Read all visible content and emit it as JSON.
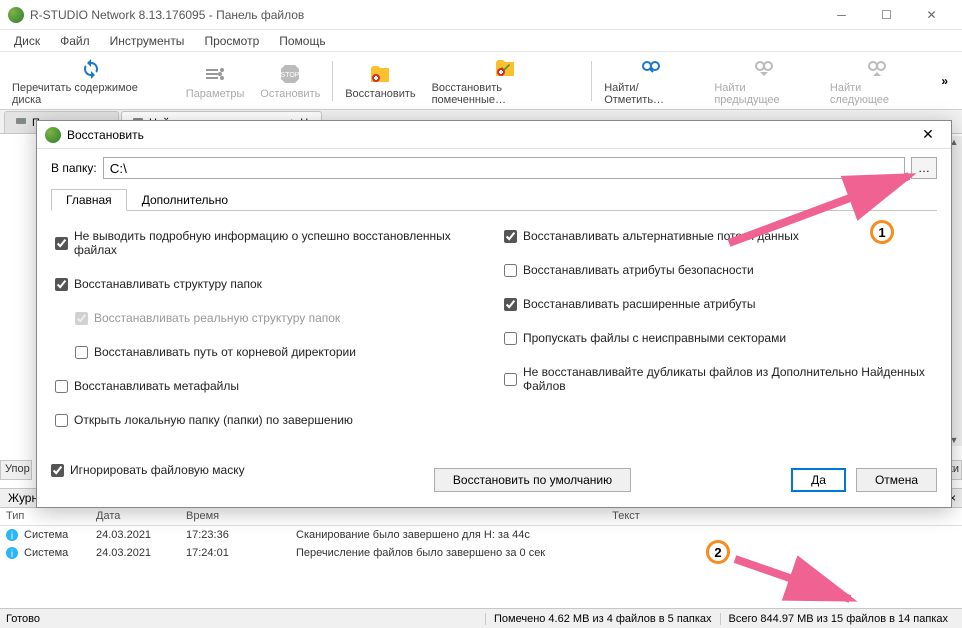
{
  "title": "R-STUDIO Network 8.13.176095 - Панель файлов",
  "menubar": [
    "Диск",
    "Файл",
    "Инструменты",
    "Просмотр",
    "Помощь"
  ],
  "toolbar": [
    {
      "label": "Перечитать содержимое диска",
      "kind": "refresh",
      "enabled": true
    },
    {
      "label": "Параметры",
      "kind": "params",
      "enabled": false
    },
    {
      "label": "Остановить",
      "kind": "stop",
      "enabled": false
    },
    {
      "sep": true
    },
    {
      "label": "Восстановить",
      "kind": "recover",
      "enabled": true
    },
    {
      "label": "Восстановить помеченные…",
      "kind": "recover-marked",
      "enabled": true
    },
    {
      "sep": true
    },
    {
      "label": "Найти/Отметить…",
      "kind": "find",
      "enabled": true
    },
    {
      "label": "Найти предыдущее",
      "kind": "find-prev",
      "enabled": false
    },
    {
      "label": "Найти следующее",
      "kind": "find-next",
      "enabled": false
    }
  ],
  "file_tabs": [
    {
      "label": "Панель дисков",
      "active": false
    },
    {
      "label": "Найденные по сигнатурам -> H:",
      "active": true
    }
  ],
  "clipped": {
    "upak": "Упор",
    "nki": "нки"
  },
  "journal": {
    "label": "Журн",
    "close": "×"
  },
  "log_header": {
    "type": "Тип",
    "date": "Дата",
    "time": "Время",
    "text": "Текст"
  },
  "log_rows": [
    {
      "type": "Система",
      "date": "24.03.2021",
      "time": "17:23:36",
      "text": "Сканирование было завершено для H: за 44с"
    },
    {
      "type": "Система",
      "date": "24.03.2021",
      "time": "17:24:01",
      "text": "Перечисление файлов было завершено за 0 сек"
    }
  ],
  "status": {
    "ready": "Готово",
    "marked": "Помечено 4.62 MB из 4 файлов в 5 папках",
    "total": "Всего 844.97 MB из 15 файлов в 14 папках"
  },
  "dialog": {
    "title": "Восстановить",
    "path_label": "В папку:",
    "path_value": "C:\\",
    "browse": "…",
    "tabs": [
      "Главная",
      "Дополнительно"
    ],
    "opts_left": [
      {
        "label": "Не выводить подробную информацию о успешно восстановленных файлах",
        "checked": true
      },
      {
        "label": "Восстанавливать структуру папок",
        "checked": true
      },
      {
        "label": "Восстанавливать реальную структуру папок",
        "checked": true,
        "disabled": true,
        "indent": true
      },
      {
        "label": "Восстанавливать путь от корневой директории",
        "checked": false,
        "indent": true
      },
      {
        "label": "Восстанавливать метафайлы",
        "checked": false
      },
      {
        "label": "Открыть локальную папку (папки) по завершению",
        "checked": false
      }
    ],
    "opts_right": [
      {
        "label": "Восстанавливать альтернативные потоки данных",
        "checked": true
      },
      {
        "label": "Восстанавливать атрибуты безопасности",
        "checked": false
      },
      {
        "label": "Восстанавливать расширенные атрибуты",
        "checked": true
      },
      {
        "label": "Пропускать файлы с неисправными секторами",
        "checked": false
      },
      {
        "label": "Не восстанавливайте дубликаты файлов из Дополнительно Найденных Файлов",
        "checked": false
      }
    ],
    "ignore_mask": {
      "label": "Игнорировать файловую маску",
      "checked": true
    },
    "restore_defaults": "Восстановить по умолчанию",
    "ok": "Да",
    "cancel": "Отмена"
  },
  "callouts": {
    "one": "1",
    "two": "2"
  }
}
